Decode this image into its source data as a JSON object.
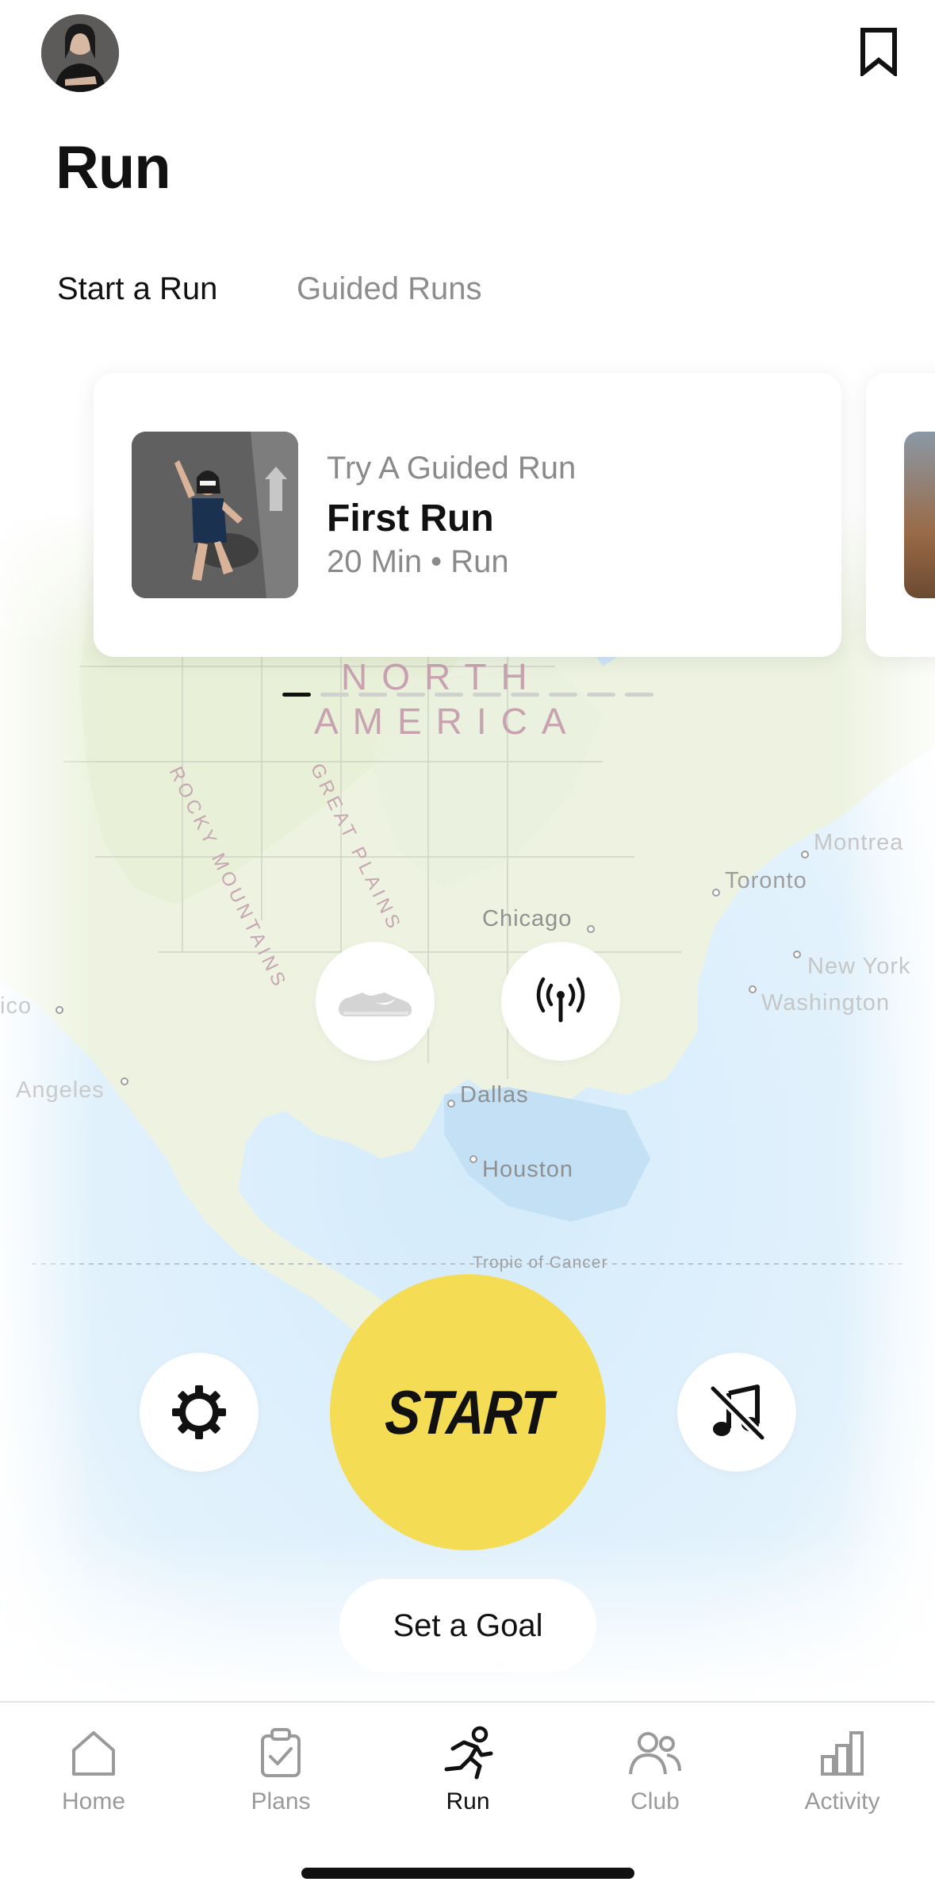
{
  "header": {
    "avatar_alt": "profile",
    "title": "Run"
  },
  "tabs": [
    {
      "label": "Start a Run",
      "active": true
    },
    {
      "label": "Guided Runs",
      "active": false
    }
  ],
  "card": {
    "kicker": "Try A Guided Run",
    "title": "First Run",
    "meta": "20 Min • Run"
  },
  "pager": {
    "count": 10,
    "active_index": 0
  },
  "map": {
    "continent_line1": "NORTH",
    "continent_line2": "AMERICA",
    "ranges": [
      "ROCKY MOUNTAINS",
      "GREAT PLAINS"
    ],
    "cities": [
      "Chicago",
      "Toronto",
      "Montrea",
      "New York",
      "Washington",
      "Dallas",
      "Houston",
      "Angeles",
      "ico"
    ],
    "tropic": "Tropic of Cancer"
  },
  "actions": {
    "start_label": "START",
    "goal_label": "Set a Goal",
    "start_color": "#f5dc55"
  },
  "icons": {
    "shoe": "shoe-icon",
    "signal": "broadcast-icon",
    "settings": "gear-icon",
    "music": "music-off-icon",
    "bookmark": "bookmark-icon"
  },
  "nav": [
    {
      "label": "Home",
      "icon": "home-icon",
      "active": false
    },
    {
      "label": "Plans",
      "icon": "clipboard-check-icon",
      "active": false
    },
    {
      "label": "Run",
      "icon": "runner-icon",
      "active": true
    },
    {
      "label": "Club",
      "icon": "people-icon",
      "active": false
    },
    {
      "label": "Activity",
      "icon": "bar-chart-icon",
      "active": false
    }
  ]
}
